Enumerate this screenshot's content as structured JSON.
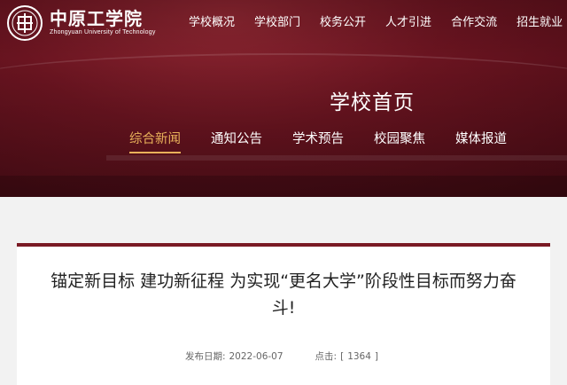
{
  "logo": {
    "name_cn": "中原工学院",
    "name_en": "Zhongyuan University of Technology"
  },
  "top_nav": [
    "学校概况",
    "学校部门",
    "校务公开",
    "人才引进",
    "合作交流",
    "招生就业"
  ],
  "page_title": "学校首页",
  "sub_nav": [
    {
      "label": "综合新闻",
      "active": true
    },
    {
      "label": "通知公告",
      "active": false
    },
    {
      "label": "学术预告",
      "active": false
    },
    {
      "label": "校园聚焦",
      "active": false
    },
    {
      "label": "媒体报道",
      "active": false
    }
  ],
  "article": {
    "title": "锚定新目标 建功新征程 为实现“更名大学”阶段性目标而努力奋斗!",
    "date_label": "发布日期:",
    "date": "2022-06-07",
    "hits_label": "点击:",
    "hits_open": "[",
    "hits": "1364",
    "hits_close": "]"
  },
  "colors": {
    "banner": "#6a1420",
    "accent": "#e8b15a",
    "card_border": "#7a1a24"
  }
}
